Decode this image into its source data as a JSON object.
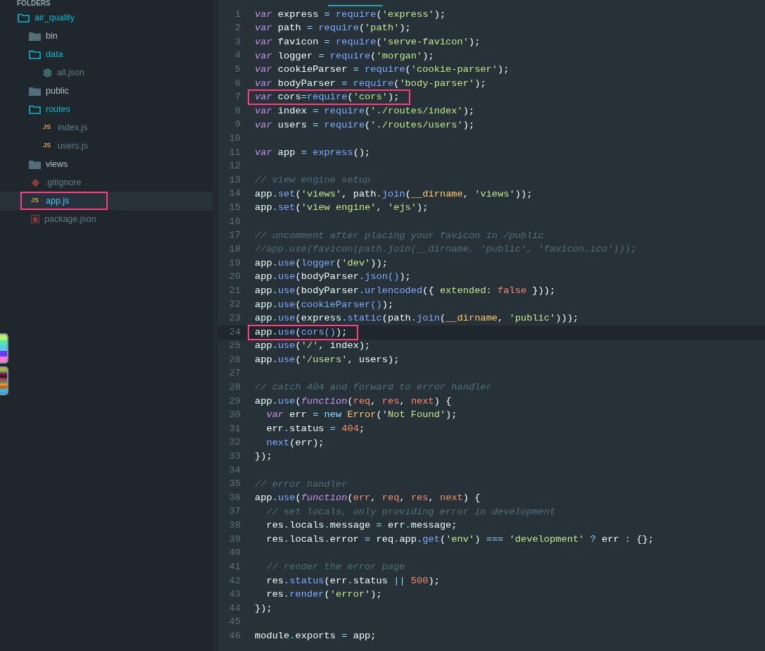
{
  "sidebar": {
    "header": "FOLDERS",
    "tree": [
      {
        "name": "air_quality",
        "kind": "folder",
        "expanded": true,
        "selected": false,
        "highlighted": false,
        "children": [
          {
            "name": "bin",
            "kind": "folder",
            "expanded": false,
            "selected": false,
            "highlighted": false
          },
          {
            "name": "data",
            "kind": "folder",
            "expanded": true,
            "selected": false,
            "highlighted": false,
            "children": [
              {
                "name": "all.json",
                "kind": "config",
                "selected": false,
                "highlighted": false
              }
            ]
          },
          {
            "name": "public",
            "kind": "folder",
            "expanded": false,
            "selected": false,
            "highlighted": false
          },
          {
            "name": "routes",
            "kind": "folder",
            "expanded": true,
            "selected": false,
            "highlighted": false,
            "children": [
              {
                "name": "index.js",
                "kind": "js",
                "badge": "JS",
                "selected": false,
                "highlighted": false
              },
              {
                "name": "users.js",
                "kind": "js",
                "badge": "JS",
                "selected": false,
                "highlighted": false
              }
            ]
          },
          {
            "name": "views",
            "kind": "folder",
            "expanded": false,
            "selected": false,
            "highlighted": false
          },
          {
            "name": ".gitignore",
            "kind": "git",
            "selected": false,
            "highlighted": false
          },
          {
            "name": "app.js",
            "kind": "js",
            "badge": "JS",
            "selected": true,
            "highlighted": true
          },
          {
            "name": "package.json",
            "kind": "npm",
            "selected": false,
            "highlighted": false
          }
        ]
      }
    ]
  },
  "editor": {
    "lines": [
      {
        "number": "1",
        "current": false,
        "highlighted": false,
        "tokens": [
          {
            "text": "var",
            "kind": "kw"
          },
          {
            "text": " express ",
            "kind": "plain"
          },
          {
            "text": "= ",
            "kind": "op"
          },
          {
            "text": "require",
            "kind": "fn"
          },
          {
            "text": "(",
            "kind": "plain"
          },
          {
            "text": "'express'",
            "kind": "str"
          },
          {
            "text": ");",
            "kind": "plain"
          }
        ]
      },
      {
        "number": "2",
        "current": false,
        "highlighted": false,
        "tokens": [
          {
            "text": "var",
            "kind": "kw"
          },
          {
            "text": " path ",
            "kind": "plain"
          },
          {
            "text": "= ",
            "kind": "op"
          },
          {
            "text": "require",
            "kind": "fn"
          },
          {
            "text": "(",
            "kind": "plain"
          },
          {
            "text": "'path'",
            "kind": "str"
          },
          {
            "text": ");",
            "kind": "plain"
          }
        ]
      },
      {
        "number": "3",
        "current": false,
        "highlighted": false,
        "tokens": [
          {
            "text": "var",
            "kind": "kw"
          },
          {
            "text": " favicon ",
            "kind": "plain"
          },
          {
            "text": "= ",
            "kind": "op"
          },
          {
            "text": "require",
            "kind": "fn"
          },
          {
            "text": "(",
            "kind": "plain"
          },
          {
            "text": "'serve-favicon'",
            "kind": "str"
          },
          {
            "text": ");",
            "kind": "plain"
          }
        ]
      },
      {
        "number": "4",
        "current": false,
        "highlighted": false,
        "tokens": [
          {
            "text": "var",
            "kind": "kw"
          },
          {
            "text": " logger ",
            "kind": "plain"
          },
          {
            "text": "= ",
            "kind": "op"
          },
          {
            "text": "require",
            "kind": "fn"
          },
          {
            "text": "(",
            "kind": "plain"
          },
          {
            "text": "'morgan'",
            "kind": "str"
          },
          {
            "text": ");",
            "kind": "plain"
          }
        ]
      },
      {
        "number": "5",
        "current": false,
        "highlighted": false,
        "tokens": [
          {
            "text": "var",
            "kind": "kw"
          },
          {
            "text": " cookieParser ",
            "kind": "plain"
          },
          {
            "text": "= ",
            "kind": "op"
          },
          {
            "text": "require",
            "kind": "fn"
          },
          {
            "text": "(",
            "kind": "plain"
          },
          {
            "text": "'cookie-parser'",
            "kind": "str"
          },
          {
            "text": ");",
            "kind": "plain"
          }
        ]
      },
      {
        "number": "6",
        "current": false,
        "highlighted": false,
        "tokens": [
          {
            "text": "var",
            "kind": "kw"
          },
          {
            "text": " bodyParser ",
            "kind": "plain"
          },
          {
            "text": "= ",
            "kind": "op"
          },
          {
            "text": "require",
            "kind": "fn"
          },
          {
            "text": "(",
            "kind": "plain"
          },
          {
            "text": "'body-parser'",
            "kind": "str"
          },
          {
            "text": ");",
            "kind": "plain"
          }
        ]
      },
      {
        "number": "7",
        "current": false,
        "highlighted": true,
        "tokens": [
          {
            "text": "var",
            "kind": "kw"
          },
          {
            "text": " cors",
            "kind": "plain"
          },
          {
            "text": "=",
            "kind": "op"
          },
          {
            "text": "require",
            "kind": "fn"
          },
          {
            "text": "(",
            "kind": "plain"
          },
          {
            "text": "'cors'",
            "kind": "str"
          },
          {
            "text": ");",
            "kind": "plain"
          }
        ]
      },
      {
        "number": "8",
        "current": false,
        "highlighted": false,
        "tokens": [
          {
            "text": "var",
            "kind": "kw"
          },
          {
            "text": " index ",
            "kind": "plain"
          },
          {
            "text": "= ",
            "kind": "op"
          },
          {
            "text": "require",
            "kind": "fn"
          },
          {
            "text": "(",
            "kind": "plain"
          },
          {
            "text": "'./routes/index'",
            "kind": "str"
          },
          {
            "text": ");",
            "kind": "plain"
          }
        ]
      },
      {
        "number": "9",
        "current": false,
        "highlighted": false,
        "tokens": [
          {
            "text": "var",
            "kind": "kw"
          },
          {
            "text": " users ",
            "kind": "plain"
          },
          {
            "text": "= ",
            "kind": "op"
          },
          {
            "text": "require",
            "kind": "fn"
          },
          {
            "text": "(",
            "kind": "plain"
          },
          {
            "text": "'./routes/users'",
            "kind": "str"
          },
          {
            "text": ");",
            "kind": "plain"
          }
        ]
      },
      {
        "number": "10",
        "current": false,
        "highlighted": false
      },
      {
        "number": "11",
        "current": false,
        "highlighted": false,
        "tokens": [
          {
            "text": "var",
            "kind": "kw"
          },
          {
            "text": " app ",
            "kind": "plain"
          },
          {
            "text": "= ",
            "kind": "op"
          },
          {
            "text": "express",
            "kind": "fn"
          },
          {
            "text": "();",
            "kind": "plain"
          }
        ]
      },
      {
        "number": "12",
        "current": false,
        "highlighted": false
      },
      {
        "number": "13",
        "current": false,
        "highlighted": false,
        "tokens": [
          {
            "text": "// view engine setup",
            "kind": "cmt"
          }
        ]
      },
      {
        "number": "14",
        "current": false,
        "highlighted": false,
        "tokens": [
          {
            "text": "app",
            "kind": "plain"
          },
          {
            "text": ".",
            "kind": "op"
          },
          {
            "text": "set",
            "kind": "fn"
          },
          {
            "text": "(",
            "kind": "plain"
          },
          {
            "text": "'views'",
            "kind": "str"
          },
          {
            "text": ", path",
            "kind": "plain"
          },
          {
            "text": ".",
            "kind": "op"
          },
          {
            "text": "join",
            "kind": "fn"
          },
          {
            "text": "(",
            "kind": "plain"
          },
          {
            "text": "__dirname",
            "kind": "cls"
          },
          {
            "text": ", ",
            "kind": "plain"
          },
          {
            "text": "'views'",
            "kind": "str"
          },
          {
            "text": "));",
            "kind": "plain"
          }
        ]
      },
      {
        "number": "15",
        "current": false,
        "highlighted": false,
        "tokens": [
          {
            "text": "app",
            "kind": "plain"
          },
          {
            "text": ".",
            "kind": "op"
          },
          {
            "text": "set",
            "kind": "fn"
          },
          {
            "text": "(",
            "kind": "plain"
          },
          {
            "text": "'view engine'",
            "kind": "str"
          },
          {
            "text": ", ",
            "kind": "plain"
          },
          {
            "text": "'ejs'",
            "kind": "str"
          },
          {
            "text": ");",
            "kind": "plain"
          }
        ]
      },
      {
        "number": "16",
        "current": false,
        "highlighted": false
      },
      {
        "number": "17",
        "current": false,
        "highlighted": false,
        "tokens": [
          {
            "text": "// uncomment after placing your favicon in /public",
            "kind": "cmt"
          }
        ]
      },
      {
        "number": "18",
        "current": false,
        "highlighted": false,
        "tokens": [
          {
            "text": "//app.use(favicon(path.join(__dirname, 'public', 'favicon.ico')));",
            "kind": "cmt"
          }
        ]
      },
      {
        "number": "19",
        "current": false,
        "highlighted": false,
        "tokens": [
          {
            "text": "app",
            "kind": "plain"
          },
          {
            "text": ".",
            "kind": "op"
          },
          {
            "text": "use",
            "kind": "fn"
          },
          {
            "text": "(",
            "kind": "plain"
          },
          {
            "text": "logger",
            "kind": "fn"
          },
          {
            "text": "(",
            "kind": "plain"
          },
          {
            "text": "'dev'",
            "kind": "str"
          },
          {
            "text": "));",
            "kind": "plain"
          }
        ]
      },
      {
        "number": "20",
        "current": false,
        "highlighted": false,
        "tokens": [
          {
            "text": "app",
            "kind": "plain"
          },
          {
            "text": ".",
            "kind": "op"
          },
          {
            "text": "use",
            "kind": "fn"
          },
          {
            "text": "(bodyParser",
            "kind": "plain"
          },
          {
            "text": ".",
            "kind": "op"
          },
          {
            "text": "json()",
            "kind": "fn"
          },
          {
            "text": ");",
            "kind": "plain"
          }
        ]
      },
      {
        "number": "21",
        "current": false,
        "highlighted": false,
        "tokens": [
          {
            "text": "app",
            "kind": "plain"
          },
          {
            "text": ".",
            "kind": "op"
          },
          {
            "text": "use",
            "kind": "fn"
          },
          {
            "text": "(bodyParser",
            "kind": "plain"
          },
          {
            "text": ".",
            "kind": "op"
          },
          {
            "text": "urlencoded",
            "kind": "fn"
          },
          {
            "text": "({ ",
            "kind": "plain"
          },
          {
            "text": "extended: ",
            "kind": "str"
          },
          {
            "text": "false",
            "kind": "num"
          },
          {
            "text": " }));",
            "kind": "plain"
          }
        ]
      },
      {
        "number": "22",
        "current": false,
        "highlighted": false,
        "tokens": [
          {
            "text": "app",
            "kind": "plain"
          },
          {
            "text": ".",
            "kind": "op"
          },
          {
            "text": "use",
            "kind": "fn"
          },
          {
            "text": "(",
            "kind": "plain"
          },
          {
            "text": "cookieParser()",
            "kind": "fn"
          },
          {
            "text": ");",
            "kind": "plain"
          }
        ]
      },
      {
        "number": "23",
        "current": false,
        "highlighted": false,
        "tokens": [
          {
            "text": "app",
            "kind": "plain"
          },
          {
            "text": ".",
            "kind": "op"
          },
          {
            "text": "use",
            "kind": "fn"
          },
          {
            "text": "(express",
            "kind": "plain"
          },
          {
            "text": ".",
            "kind": "op"
          },
          {
            "text": "static",
            "kind": "fn"
          },
          {
            "text": "(path",
            "kind": "plain"
          },
          {
            "text": ".",
            "kind": "op"
          },
          {
            "text": "join",
            "kind": "fn"
          },
          {
            "text": "(",
            "kind": "plain"
          },
          {
            "text": "__dirname",
            "kind": "cls"
          },
          {
            "text": ", ",
            "kind": "plain"
          },
          {
            "text": "'public'",
            "kind": "str"
          },
          {
            "text": ")));",
            "kind": "plain"
          }
        ]
      },
      {
        "number": "24",
        "current": true,
        "highlighted": true,
        "tokens": [
          {
            "text": "app",
            "kind": "plain"
          },
          {
            "text": ".",
            "kind": "op"
          },
          {
            "text": "use",
            "kind": "fn"
          },
          {
            "text": "(",
            "kind": "plain"
          },
          {
            "text": "cors()",
            "kind": "fn"
          },
          {
            "text": ");",
            "kind": "plain"
          }
        ]
      },
      {
        "number": "25",
        "current": false,
        "highlighted": false,
        "tokens": [
          {
            "text": "app",
            "kind": "plain"
          },
          {
            "text": ".",
            "kind": "op"
          },
          {
            "text": "use",
            "kind": "fn"
          },
          {
            "text": "(",
            "kind": "plain"
          },
          {
            "text": "'/'",
            "kind": "str"
          },
          {
            "text": ", index);",
            "kind": "plain"
          }
        ]
      },
      {
        "number": "26",
        "current": false,
        "highlighted": false,
        "tokens": [
          {
            "text": "app",
            "kind": "plain"
          },
          {
            "text": ".",
            "kind": "op"
          },
          {
            "text": "use",
            "kind": "fn"
          },
          {
            "text": "(",
            "kind": "plain"
          },
          {
            "text": "'/users'",
            "kind": "str"
          },
          {
            "text": ", users);",
            "kind": "plain"
          }
        ]
      },
      {
        "number": "27",
        "current": false,
        "highlighted": false
      },
      {
        "number": "28",
        "current": false,
        "highlighted": false,
        "tokens": [
          {
            "text": "// catch 404 and forward to error handler",
            "kind": "cmt"
          }
        ]
      },
      {
        "number": "29",
        "current": false,
        "highlighted": false,
        "tokens": [
          {
            "text": "app",
            "kind": "plain"
          },
          {
            "text": ".",
            "kind": "op"
          },
          {
            "text": "use",
            "kind": "fn"
          },
          {
            "text": "(",
            "kind": "plain"
          },
          {
            "text": "function",
            "kind": "kw"
          },
          {
            "text": "(",
            "kind": "plain"
          },
          {
            "text": "req",
            "kind": "num"
          },
          {
            "text": ", ",
            "kind": "plain"
          },
          {
            "text": "res",
            "kind": "num"
          },
          {
            "text": ", ",
            "kind": "plain"
          },
          {
            "text": "next",
            "kind": "num"
          },
          {
            "text": ") {",
            "kind": "plain"
          }
        ]
      },
      {
        "number": "30",
        "current": false,
        "highlighted": false,
        "tokens": [
          {
            "text": "  var",
            "kind": "kw"
          },
          {
            "text": " err ",
            "kind": "plain"
          },
          {
            "text": "= ",
            "kind": "op"
          },
          {
            "text": "new ",
            "kind": "op"
          },
          {
            "text": "Error",
            "kind": "cls"
          },
          {
            "text": "(",
            "kind": "plain"
          },
          {
            "text": "'Not Found'",
            "kind": "str"
          },
          {
            "text": ");",
            "kind": "plain"
          }
        ]
      },
      {
        "number": "31",
        "current": false,
        "highlighted": false,
        "tokens": [
          {
            "text": "  err",
            "kind": "plain"
          },
          {
            "text": ".",
            "kind": "op"
          },
          {
            "text": "status ",
            "kind": "plain"
          },
          {
            "text": "= ",
            "kind": "op"
          },
          {
            "text": "404",
            "kind": "num"
          },
          {
            "text": ";",
            "kind": "plain"
          }
        ]
      },
      {
        "number": "32",
        "current": false,
        "highlighted": false,
        "tokens": [
          {
            "text": "  next",
            "kind": "fn"
          },
          {
            "text": "(err);",
            "kind": "plain"
          }
        ]
      },
      {
        "number": "33",
        "current": false,
        "highlighted": false,
        "tokens": [
          {
            "text": "});",
            "kind": "plain"
          }
        ]
      },
      {
        "number": "34",
        "current": false,
        "highlighted": false
      },
      {
        "number": "35",
        "current": false,
        "highlighted": false,
        "tokens": [
          {
            "text": "// error handler",
            "kind": "cmt"
          }
        ]
      },
      {
        "number": "36",
        "current": false,
        "highlighted": false,
        "tokens": [
          {
            "text": "app",
            "kind": "plain"
          },
          {
            "text": ".",
            "kind": "op"
          },
          {
            "text": "use",
            "kind": "fn"
          },
          {
            "text": "(",
            "kind": "plain"
          },
          {
            "text": "function",
            "kind": "kw"
          },
          {
            "text": "(",
            "kind": "plain"
          },
          {
            "text": "err",
            "kind": "num"
          },
          {
            "text": ", ",
            "kind": "plain"
          },
          {
            "text": "req",
            "kind": "num"
          },
          {
            "text": ", ",
            "kind": "plain"
          },
          {
            "text": "res",
            "kind": "num"
          },
          {
            "text": ", ",
            "kind": "plain"
          },
          {
            "text": "next",
            "kind": "num"
          },
          {
            "text": ") {",
            "kind": "plain"
          }
        ]
      },
      {
        "number": "37",
        "current": false,
        "highlighted": false,
        "tokens": [
          {
            "text": "  // set locals, only providing error in development",
            "kind": "cmt"
          }
        ]
      },
      {
        "number": "38",
        "current": false,
        "highlighted": false,
        "tokens": [
          {
            "text": "  res",
            "kind": "plain"
          },
          {
            "text": ".",
            "kind": "op"
          },
          {
            "text": "locals",
            "kind": "plain"
          },
          {
            "text": ".",
            "kind": "op"
          },
          {
            "text": "message ",
            "kind": "plain"
          },
          {
            "text": "=",
            "kind": "op"
          },
          {
            "text": " err",
            "kind": "plain"
          },
          {
            "text": ".",
            "kind": "op"
          },
          {
            "text": "message;",
            "kind": "plain"
          }
        ]
      },
      {
        "number": "39",
        "current": false,
        "highlighted": false,
        "tokens": [
          {
            "text": "  res",
            "kind": "plain"
          },
          {
            "text": ".",
            "kind": "op"
          },
          {
            "text": "locals",
            "kind": "plain"
          },
          {
            "text": ".",
            "kind": "op"
          },
          {
            "text": "error ",
            "kind": "plain"
          },
          {
            "text": "=",
            "kind": "op"
          },
          {
            "text": " req",
            "kind": "plain"
          },
          {
            "text": ".",
            "kind": "op"
          },
          {
            "text": "app",
            "kind": "plain"
          },
          {
            "text": ".",
            "kind": "op"
          },
          {
            "text": "get",
            "kind": "fn"
          },
          {
            "text": "(",
            "kind": "plain"
          },
          {
            "text": "'env'",
            "kind": "str"
          },
          {
            "text": ") ",
            "kind": "plain"
          },
          {
            "text": "=== ",
            "kind": "op"
          },
          {
            "text": "'development' ",
            "kind": "str"
          },
          {
            "text": "?",
            "kind": "op"
          },
          {
            "text": " err ",
            "kind": "plain"
          },
          {
            "text": ":",
            "kind": "op"
          },
          {
            "text": " {};",
            "kind": "plain"
          }
        ]
      },
      {
        "number": "40",
        "current": false,
        "highlighted": false
      },
      {
        "number": "41",
        "current": false,
        "highlighted": false,
        "tokens": [
          {
            "text": "  // render the error page",
            "kind": "cmt"
          }
        ]
      },
      {
        "number": "42",
        "current": false,
        "highlighted": false,
        "tokens": [
          {
            "text": "  res",
            "kind": "plain"
          },
          {
            "text": ".",
            "kind": "op"
          },
          {
            "text": "status",
            "kind": "fn"
          },
          {
            "text": "(err",
            "kind": "plain"
          },
          {
            "text": ".",
            "kind": "op"
          },
          {
            "text": "status ",
            "kind": "plain"
          },
          {
            "text": "|| ",
            "kind": "op"
          },
          {
            "text": "500",
            "kind": "num"
          },
          {
            "text": ");",
            "kind": "plain"
          }
        ]
      },
      {
        "number": "43",
        "current": false,
        "highlighted": false,
        "tokens": [
          {
            "text": "  res",
            "kind": "plain"
          },
          {
            "text": ".",
            "kind": "op"
          },
          {
            "text": "render",
            "kind": "fn"
          },
          {
            "text": "(",
            "kind": "plain"
          },
          {
            "text": "'error'",
            "kind": "str"
          },
          {
            "text": ");",
            "kind": "plain"
          }
        ]
      },
      {
        "number": "44",
        "current": false,
        "highlighted": false,
        "tokens": [
          {
            "text": "});",
            "kind": "plain"
          }
        ]
      },
      {
        "number": "45",
        "current": false,
        "highlighted": false
      },
      {
        "number": "46",
        "current": false,
        "highlighted": false,
        "tokens": [
          {
            "text": "module",
            "kind": "plain"
          },
          {
            "text": ".",
            "kind": "op"
          },
          {
            "text": "exports ",
            "kind": "plain"
          },
          {
            "text": "=",
            "kind": "op"
          },
          {
            "text": " app;",
            "kind": "plain"
          }
        ]
      }
    ]
  }
}
